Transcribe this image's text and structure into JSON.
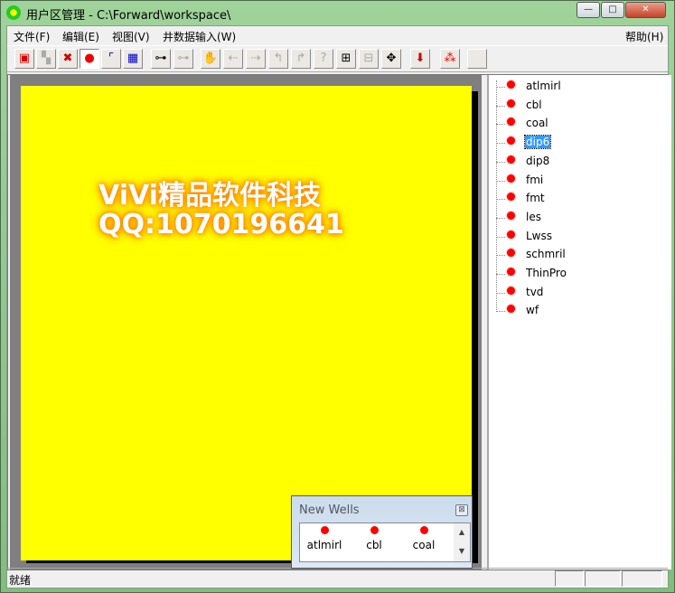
{
  "window": {
    "title": "用户区管理 - C:\\Forward\\workspace\\",
    "min": "—",
    "max": "□",
    "close": "✕"
  },
  "menu": [
    "文件(F)",
    "编辑(E)",
    "视图(V)",
    "井数据输入(W)"
  ],
  "help": "帮助(H)",
  "toolbar": [
    {
      "name": "new-well-icon",
      "glyph": "▣",
      "enabled": true
    },
    {
      "name": "copy-icon",
      "glyph": "▚",
      "enabled": false
    },
    {
      "name": "delete-icon",
      "glyph": "✖",
      "enabled": true
    },
    {
      "name": "well-marker-icon",
      "glyph": "●",
      "enabled": true,
      "pressed": true
    },
    {
      "name": "axis-icon",
      "glyph": "⌜",
      "enabled": true
    },
    {
      "name": "grid-icon",
      "glyph": "▦",
      "enabled": true
    },
    {
      "name": "binoculars-icon",
      "glyph": "⊶",
      "enabled": true
    },
    {
      "name": "binoculars-disabled-icon",
      "glyph": "⊶",
      "enabled": false
    },
    {
      "name": "hand-icon",
      "glyph": "✋",
      "enabled": false
    },
    {
      "name": "move-left-icon",
      "glyph": "⇠",
      "enabled": false
    },
    {
      "name": "move-right-icon",
      "glyph": "⇢",
      "enabled": false
    },
    {
      "name": "step-left-icon",
      "glyph": "↰",
      "enabled": false
    },
    {
      "name": "step-right-icon",
      "glyph": "↱",
      "enabled": false
    },
    {
      "name": "query-icon",
      "glyph": "?",
      "enabled": false
    },
    {
      "name": "import-icon",
      "glyph": "⊞",
      "enabled": true
    },
    {
      "name": "export-icon",
      "glyph": "⊟",
      "enabled": false
    },
    {
      "name": "pan-arrows-icon",
      "glyph": "✥",
      "enabled": true
    },
    {
      "name": "download-icon",
      "glyph": "⬇",
      "enabled": true
    },
    {
      "name": "wells-cluster-icon",
      "glyph": "⁂",
      "enabled": true
    },
    {
      "name": "blank-icon",
      "glyph": "",
      "enabled": true
    }
  ],
  "watermark": [
    "ViVi精品软件科技",
    "QQ:1070196641"
  ],
  "tree": {
    "items": [
      "atlmirl",
      "cbl",
      "coal",
      "dip6",
      "dip8",
      "fmi",
      "fmt",
      "les",
      "Lwss",
      "schmril",
      "ThinPro",
      "tvd",
      "wf"
    ],
    "selected": "dip6"
  },
  "new_wells": {
    "title": "New Wells",
    "close": "⊠",
    "items": [
      "atlmirl",
      "cbl",
      "coal"
    ],
    "scroll_up": "▲",
    "scroll_down": "▼"
  },
  "status": {
    "text": "就绪"
  },
  "colors": {
    "canvas": "#ffff00",
    "well": "#ff0000",
    "selection": "#3399ff"
  }
}
